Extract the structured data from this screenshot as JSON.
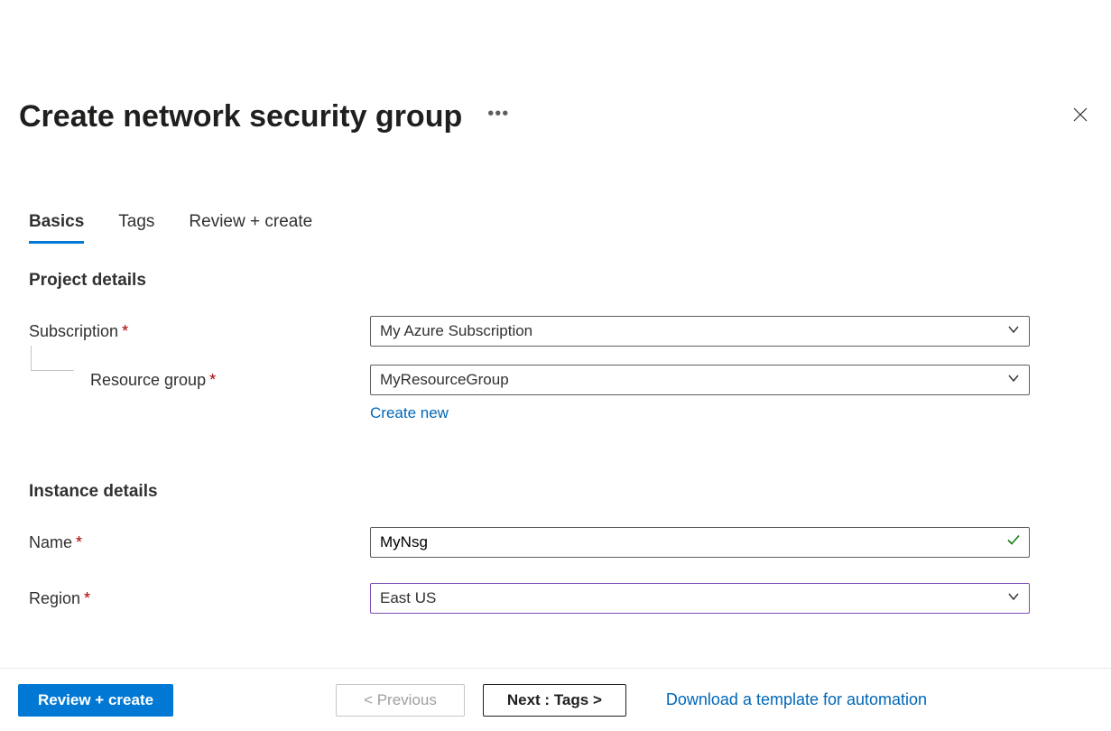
{
  "header": {
    "title": "Create network security group"
  },
  "tabs": [
    {
      "label": "Basics",
      "active": true
    },
    {
      "label": "Tags",
      "active": false
    },
    {
      "label": "Review + create",
      "active": false
    }
  ],
  "sections": {
    "project_details": {
      "heading": "Project details",
      "subscription": {
        "label": "Subscription",
        "value": "My Azure Subscription"
      },
      "resource_group": {
        "label": "Resource group",
        "value": "MyResourceGroup",
        "create_new_link": "Create new"
      }
    },
    "instance_details": {
      "heading": "Instance details",
      "name": {
        "label": "Name",
        "value": "MyNsg"
      },
      "region": {
        "label": "Region",
        "value": "East US"
      }
    }
  },
  "footer": {
    "review_create": "Review + create",
    "previous": "< Previous",
    "next": "Next : Tags >",
    "download_link": "Download a template for automation"
  }
}
